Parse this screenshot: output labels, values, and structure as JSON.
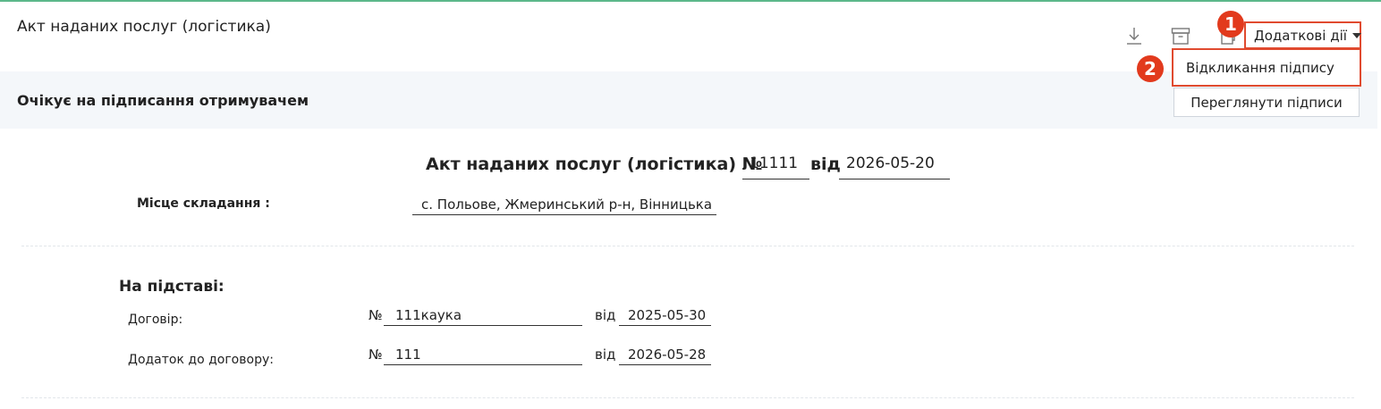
{
  "header": {
    "title": "Акт наданих послуг (логістика)",
    "icons": [
      "download-icon",
      "archive-icon",
      "copy-icon"
    ],
    "more_actions_label": "Додаткові дії",
    "badge_1": "1",
    "badge_2": "2",
    "dropdown": {
      "items": [
        {
          "label": "Відкликання підпису"
        }
      ]
    }
  },
  "status": {
    "text": "Очікує на підписання отримувачем",
    "view_signatures_label": "Переглянути підписи"
  },
  "document": {
    "heading": "Акт наданих послуг (логістика) №",
    "number": "11111",
    "date_word": "від",
    "date": "2026-05-20",
    "place_label": "Місце складання :",
    "place_value": "с. Польове, Жмеринський р-н, Вінницька"
  },
  "basis": {
    "title": "На підставі:",
    "rows": [
      {
        "label": "Договір:",
        "num_prefix": "№",
        "number": "111каука",
        "date_word": "від",
        "date": "2025-05-30"
      },
      {
        "label": "Додаток до договору:",
        "num_prefix": "№",
        "number": "111",
        "date_word": "від",
        "date": "2026-05-28"
      }
    ]
  },
  "colors": {
    "accent_green": "#5cb88a",
    "highlight_red": "#e04a2f",
    "badge_red": "#e23a1d",
    "status_bg": "#f4f7fa"
  }
}
